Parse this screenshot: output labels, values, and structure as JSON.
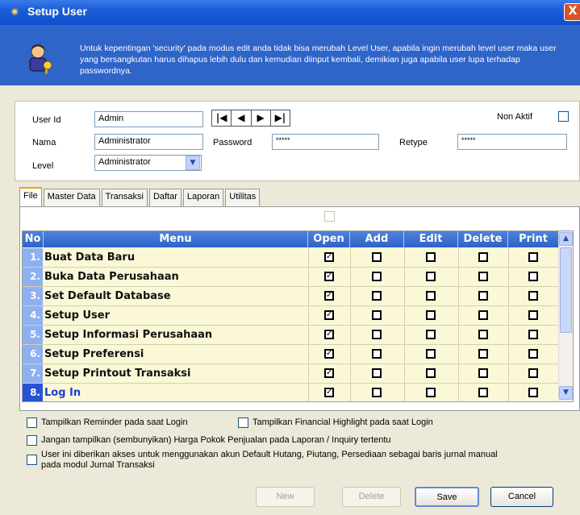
{
  "window": {
    "title": "Setup User",
    "close_label": "X"
  },
  "header": {
    "info": "Untuk kepentingan 'security' pada modus edit anda tidak bisa merubah Level User, apabila ingin merubah level user maka user yang bersangkutan harus dihapus lebih dulu dan kemudian diinput kembali, demikian juga apabila user lupa terhadap passwordnya."
  },
  "form": {
    "user_id_label": "User Id",
    "user_id_value": "Admin",
    "nama_label": "Nama",
    "nama_value": "Administrator",
    "level_label": "Level",
    "level_value": "Administrator",
    "password_label": "Password",
    "password_value": "*****",
    "retype_label": "Retype",
    "retype_value": "*****",
    "non_aktif_label": "Non Aktif",
    "non_aktif_checked": false,
    "nav_buttons": [
      "|◀",
      "◀",
      "▶",
      "▶|"
    ]
  },
  "tabs": [
    {
      "label": "File",
      "active": true
    },
    {
      "label": "Master Data",
      "active": false
    },
    {
      "label": "Transaksi",
      "active": false
    },
    {
      "label": "Daftar",
      "active": false
    },
    {
      "label": "Laporan",
      "active": false
    },
    {
      "label": "Utilitas",
      "active": false
    }
  ],
  "grid": {
    "columns": [
      "No",
      "Menu",
      "Open",
      "Add",
      "Edit",
      "Delete",
      "Print"
    ],
    "rows": [
      {
        "no": "1.",
        "menu": "Buat Data Baru",
        "open": true,
        "add": false,
        "edit": false,
        "delete": false,
        "print": false
      },
      {
        "no": "2.",
        "menu": "Buka Data Perusahaan",
        "open": true,
        "add": false,
        "edit": false,
        "delete": false,
        "print": false
      },
      {
        "no": "3.",
        "menu": "Set Default Database",
        "open": true,
        "add": false,
        "edit": false,
        "delete": false,
        "print": false
      },
      {
        "no": "4.",
        "menu": "Setup User",
        "open": true,
        "add": false,
        "edit": false,
        "delete": false,
        "print": false
      },
      {
        "no": "5.",
        "menu": "Setup Informasi Perusahaan",
        "open": true,
        "add": false,
        "edit": false,
        "delete": false,
        "print": false
      },
      {
        "no": "6.",
        "menu": "Setup Preferensi",
        "open": true,
        "add": false,
        "edit": false,
        "delete": false,
        "print": false
      },
      {
        "no": "7.",
        "menu": "Setup Printout Transaksi",
        "open": true,
        "add": false,
        "edit": false,
        "delete": false,
        "print": false
      },
      {
        "no": "8.",
        "menu": "Log In",
        "open": true,
        "add": false,
        "edit": false,
        "delete": false,
        "print": false,
        "selected": true
      }
    ]
  },
  "options": {
    "reminder": "Tampilkan Reminder pada saat Login",
    "financial": "Tampilkan Financial Highlight pada saat Login",
    "hpp": "Jangan tampilkan (sembunyikan) Harga Pokok Penjualan pada Laporan / Inquiry tertentu",
    "akun_line1": "User ini diberikan akses untuk menggunakan akun Default Hutang, Piutang, Persediaan sebagai baris jurnal manual",
    "akun_line2": "pada modul Jurnal Transaksi"
  },
  "buttons": {
    "new": "New",
    "delete": "Delete",
    "save": "Save",
    "cancel": "Cancel"
  },
  "colors": {
    "title_blue": "#0f4fcc",
    "header_blue": "#2f64c8",
    "grid_bg": "#fbf8d8",
    "grid_head": "#2e63c8"
  }
}
